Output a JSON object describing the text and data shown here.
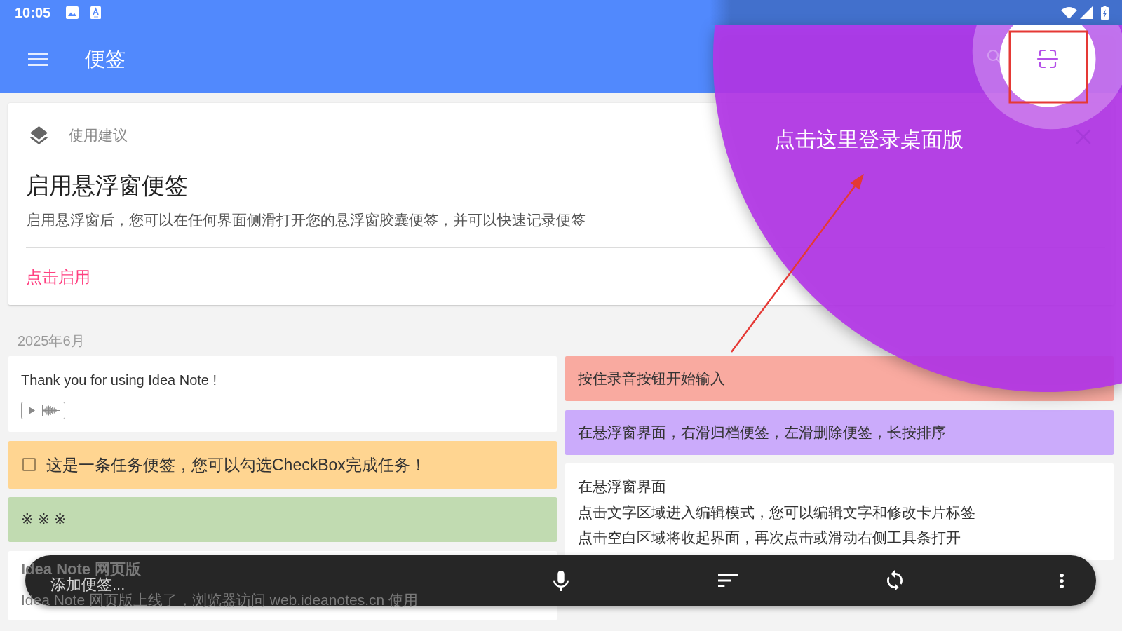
{
  "status_bar": {
    "time": "10:05"
  },
  "app_bar": {
    "title": "便签"
  },
  "tip_card": {
    "label": "使用建议",
    "title": "启用悬浮窗便签",
    "description": "启用悬浮窗后，您可以在任何界面侧滑打开您的悬浮窗胶囊便签，并可以快速记录便签",
    "action": "点击启用"
  },
  "month": "2025年6月",
  "notes_left": [
    {
      "kind": "audio",
      "color": "#ffffff",
      "text": "Thank you for using Idea Note !"
    },
    {
      "kind": "task",
      "color": "#ffd591",
      "checked": false,
      "text": "这是一条任务便签，您可以勾选CheckBox完成任务！"
    },
    {
      "kind": "text",
      "color": "#c1dbb1",
      "text": "※ ※ ※"
    },
    {
      "kind": "titled",
      "color": "#ffffff",
      "title": "Idea Note 网页版",
      "text": "Idea Note 网页版上线了，浏览器访问 web.ideanotes.cn 使用"
    }
  ],
  "notes_right": [
    {
      "kind": "text",
      "color": "#f9aaa0",
      "text": "按住录音按钮开始输入"
    },
    {
      "kind": "text",
      "color": "#cbabfb",
      "text": "在悬浮窗界面，右滑归档便签，左滑删除便签，长按排序"
    },
    {
      "kind": "multiline",
      "color": "#ffffff",
      "lines": [
        "在悬浮窗界面",
        "点击文字区域进入编辑模式，您可以编辑文字和修改卡片标签",
        "点击空白区域将收起界面，再次点击或滑动右侧工具条打开"
      ]
    }
  ],
  "compose_bar": {
    "placeholder": "添加便签..."
  },
  "tutorial": {
    "message": "点击这里登录桌面版"
  }
}
